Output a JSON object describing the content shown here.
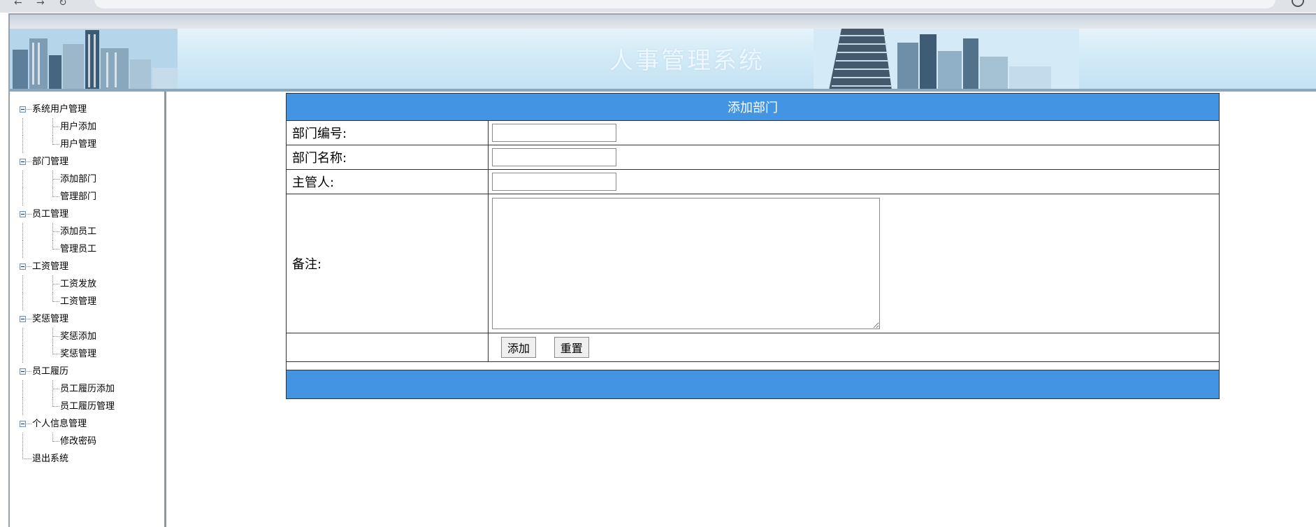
{
  "header": {
    "title": "人事管理系统"
  },
  "sidebar": {
    "groups": [
      {
        "label": "系统用户管理",
        "children": [
          "用户添加",
          "用户管理"
        ]
      },
      {
        "label": "部门管理",
        "children": [
          "添加部门",
          "管理部门"
        ]
      },
      {
        "label": "员工管理",
        "children": [
          "添加员工",
          "管理员工"
        ]
      },
      {
        "label": "工资管理",
        "children": [
          "工资发放",
          "工资管理"
        ]
      },
      {
        "label": "奖惩管理",
        "children": [
          "奖惩添加",
          "奖惩管理"
        ]
      },
      {
        "label": "员工履历",
        "children": [
          "员工履历添加",
          "员工履历管理"
        ]
      },
      {
        "label": "个人信息管理",
        "children": [
          "修改密码"
        ]
      }
    ],
    "exit_label": "退出系统"
  },
  "form": {
    "title": "添加部门",
    "dept_id_label": "部门编号:",
    "dept_id_value": "",
    "dept_name_label": "部门名称:",
    "dept_name_value": "",
    "manager_label": "主管人:",
    "manager_value": "",
    "notes_label": "备注:",
    "notes_value": "",
    "add_button": "添加",
    "reset_button": "重置"
  },
  "colors": {
    "accent": "#4395e3",
    "banner": "#d4ebf7"
  }
}
